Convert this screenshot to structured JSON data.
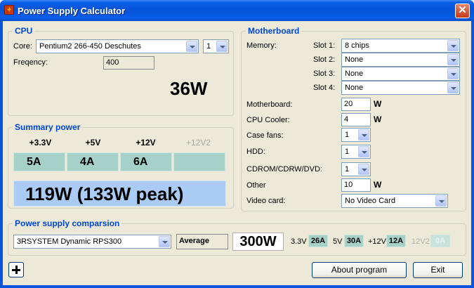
{
  "window": {
    "title": "Power Supply Calculator",
    "close_label": "✕"
  },
  "cpu": {
    "legend": "CPU",
    "core_label": "Core:",
    "core_value": "Pentium2 266-450 Deschutes",
    "count_value": "1",
    "frequency_label": "Freqency:",
    "frequency_value": "400",
    "power": "36W"
  },
  "motherboard": {
    "legend": "Motherboard",
    "memory_label": "Memory:",
    "slots": [
      {
        "label": "Slot 1:",
        "value": "8 chips"
      },
      {
        "label": "Slot 2:",
        "value": "None"
      },
      {
        "label": "Slot 3:",
        "value": "None"
      },
      {
        "label": "Slot 4:",
        "value": "None"
      }
    ],
    "motherboard_label": "Motherboard:",
    "motherboard_value": "20",
    "cpu_cooler_label": "CPU Cooler:",
    "cpu_cooler_value": "4",
    "case_fans_label": "Case fans:",
    "case_fans_value": "1",
    "hdd_label": "HDD:",
    "hdd_value": "1",
    "cdrom_label": "CDROM/CDRW/DVD:",
    "cdrom_value": "1",
    "other_label": "Other",
    "other_value": "10",
    "video_label": "Video card:",
    "video_value": "No Video Card",
    "unit_w": "W"
  },
  "summary": {
    "legend": "Summary power",
    "rails": [
      {
        "label": "+3.3V",
        "amps": "5A"
      },
      {
        "label": "+5V",
        "amps": "4A"
      },
      {
        "label": "+12V",
        "amps": "6A"
      },
      {
        "label": "+12V2",
        "amps": ""
      }
    ],
    "total": "119W (133W peak)"
  },
  "psu": {
    "legend": "Power supply comparsion",
    "model": "3RSYSTEM Dynamic RPS300",
    "rating": "Average",
    "watts": "300W",
    "rails": [
      {
        "label": "3.3V",
        "amps": "26A",
        "dim": false
      },
      {
        "label": "5V",
        "amps": "30A",
        "dim": false
      },
      {
        "label": "+12V",
        "amps": "12A",
        "dim": false
      },
      {
        "label": "12V2",
        "amps": "0A",
        "dim": true
      }
    ]
  },
  "buttons": {
    "about": "About program",
    "exit": "Exit"
  },
  "colors": {
    "title_bar": "#0a5fe8",
    "legend_text": "#0046d5",
    "amp_box": "#a6d1c8",
    "total_box": "#a9cbf4",
    "close_button": "#c6391a"
  },
  "icons": {
    "app": "power-supply-icon",
    "close": "close-icon",
    "add": "plus-icon",
    "dropdown": "chevron-down-icon"
  }
}
